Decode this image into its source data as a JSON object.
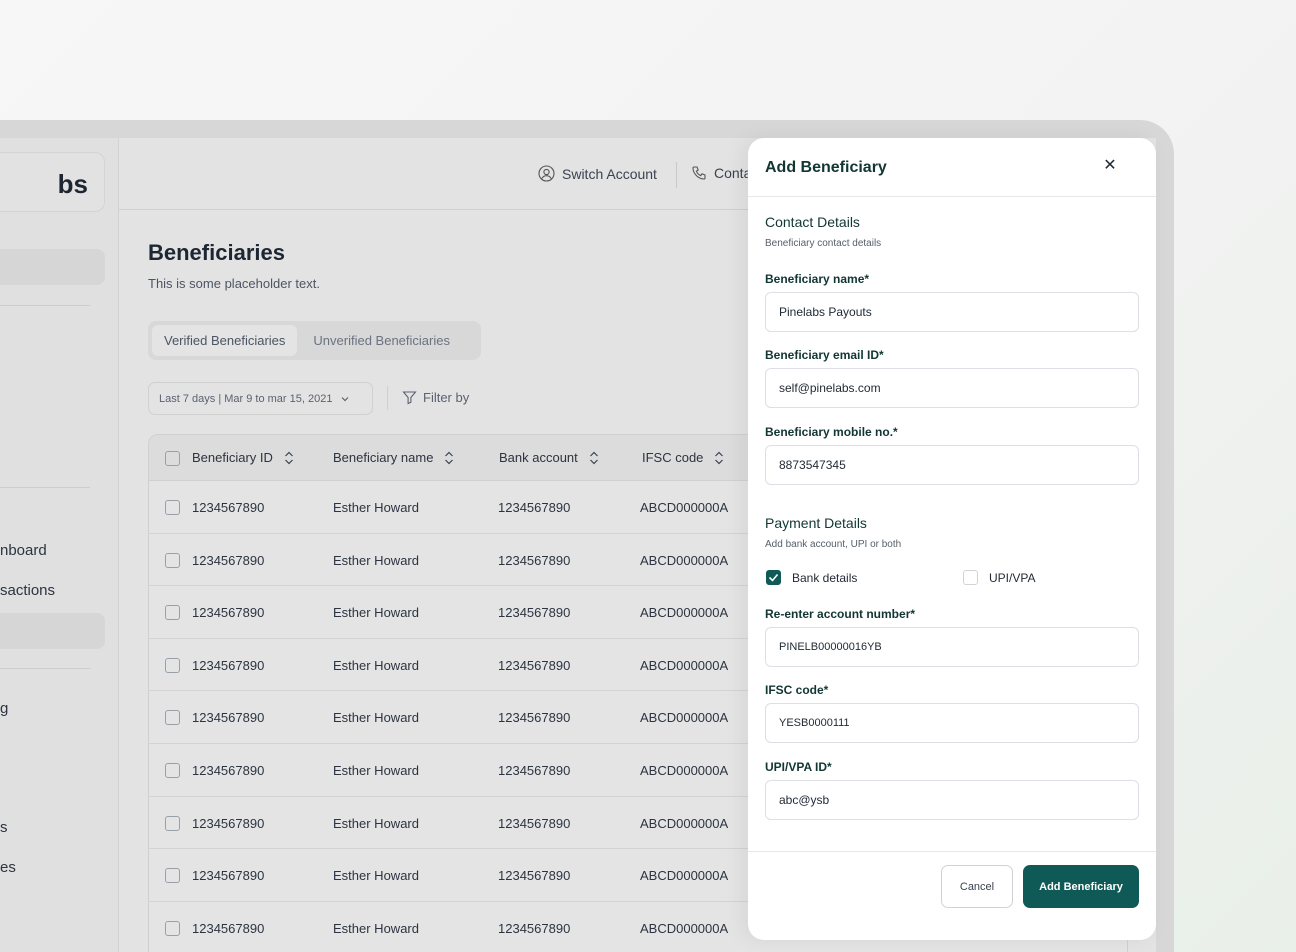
{
  "sidebar": {
    "logo": "bs",
    "items": [
      "nboard",
      "sactions",
      "g",
      "s",
      "es"
    ]
  },
  "topbar": {
    "switch_account": "Switch Account",
    "contact": "Conta"
  },
  "page": {
    "title": "Beneficiaries",
    "subtitle": "This is some placeholder text.",
    "tabs": [
      "Verified Beneficiaries",
      "Unverified Beneficiaries"
    ],
    "date_filter": "Last 7 days | Mar 9 to mar 15, 2021",
    "filter_by": "Filter by"
  },
  "table": {
    "columns": [
      "Beneficiary ID",
      "Beneficiary name",
      "Bank account",
      "IFSC code"
    ],
    "rows": [
      [
        "1234567890",
        "Esther Howard",
        "1234567890",
        "ABCD000000A"
      ],
      [
        "1234567890",
        "Esther Howard",
        "1234567890",
        "ABCD000000A"
      ],
      [
        "1234567890",
        "Esther Howard",
        "1234567890",
        "ABCD000000A"
      ],
      [
        "1234567890",
        "Esther Howard",
        "1234567890",
        "ABCD000000A"
      ],
      [
        "1234567890",
        "Esther Howard",
        "1234567890",
        "ABCD000000A"
      ],
      [
        "1234567890",
        "Esther Howard",
        "1234567890",
        "ABCD000000A"
      ],
      [
        "1234567890",
        "Esther Howard",
        "1234567890",
        "ABCD000000A"
      ],
      [
        "1234567890",
        "Esther Howard",
        "1234567890",
        "ABCD000000A"
      ],
      [
        "1234567890",
        "Esther Howard",
        "1234567890",
        "ABCD000000A"
      ]
    ]
  },
  "modal": {
    "title": "Add Beneficiary",
    "contact": {
      "title": "Contact Details",
      "subtitle": "Beneficiary contact details",
      "name_label": "Beneficiary name*",
      "name_value": "Pinelabs Payouts",
      "email_label": "Beneficiary email ID*",
      "email_value": "self@pinelabs.com",
      "mobile_label": "Beneficiary mobile no.*",
      "mobile_value": "8873547345"
    },
    "payment": {
      "title": "Payment Details",
      "subtitle": "Add bank account, UPI or both",
      "bank_details_label": "Bank details",
      "bank_details_checked": true,
      "upi_label": "UPI/VPA",
      "upi_checked": false,
      "account_label": "Re-enter account number*",
      "account_value": "PINELB00000016YB",
      "ifsc_label": "IFSC code*",
      "ifsc_value": "YESB0000111",
      "vpa_label": "UPI/VPA ID*",
      "vpa_value": "abc@ysb"
    },
    "cancel_label": "Cancel",
    "submit_label": "Add Beneficiary"
  },
  "colors": {
    "primary": "#0f5a57",
    "heading": "#113633"
  }
}
